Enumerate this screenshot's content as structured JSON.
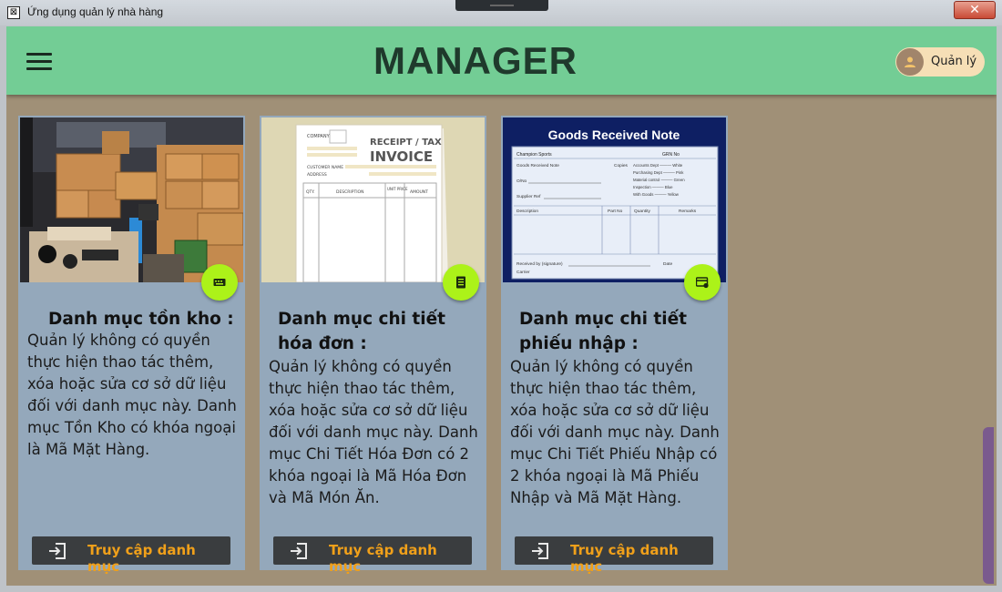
{
  "window": {
    "title": "Ứng dụng quản lý nhà hàng",
    "app_icon_glyph": "⊠",
    "close_glyph": "✕"
  },
  "header": {
    "title": "MANAGER",
    "menu_icon": "hamburger-icon",
    "user": {
      "label": "Quản lý",
      "icon": "user-icon"
    },
    "background": "#73cd95"
  },
  "cards": [
    {
      "title": "Danh mục tồn kho :",
      "description": "Quản lý không có quyền thực hiện thao tác thêm, xóa hoặc sửa cơ sở dữ liệu đối với danh mục này. Danh mục Tồn Kho có khóa ngoại là Mã Mặt Hàng.",
      "fab_icon": "keyboard-icon",
      "button_label": "Truy cập danh mục",
      "button_icon": "login-icon"
    },
    {
      "title": "Danh mục chi tiết hóa đơn :",
      "description": "Quản lý không có quyền thực hiện thao tác thêm, xóa hoặc sửa cơ sở dữ liệu đối với danh mục này. Danh mục Chi Tiết Hóa Đơn có 2 khóa ngoại là Mã Hóa Đơn và Mã Món Ăn.",
      "fab_icon": "receipt-icon",
      "button_label": "Truy cập danh mục",
      "button_icon": "login-icon",
      "image_text": {
        "line1": "RECEIPT / TAX",
        "line2": "INVOICE",
        "company": "COMPANY",
        "customer_name": "CUSTOMER NAME",
        "address": "ADDRESS",
        "columns": [
          "QTY.",
          "DESCRIPTION",
          "UNIT PRICE",
          "AMOUNT"
        ]
      }
    },
    {
      "title": "Danh mục chi tiết phiếu nhập :",
      "description": "Quản lý không có quyền thực hiện thao tác thêm, xóa hoặc sửa cơ sở dữ liệu đối với danh mục này. Danh mục Chi Tiết Phiếu Nhập có 2 khóa ngoại là Mã Phiếu Nhập và Mã Mặt Hàng.",
      "fab_icon": "payment-card-icon",
      "button_label": "Truy cập danh mục",
      "button_icon": "login-icon",
      "image_text": {
        "heading": "Goods Received Note",
        "company": "Champion Sports",
        "grn_no": "GRN No",
        "form_name": "Goods Received Note",
        "copies": "Copies",
        "copy_list": [
          "Accounts Dept ——— White",
          "Purchasing Dept ——— Pink",
          "Material control ——— Green",
          "Inspection ——— Blue",
          "With Goods ——— Yellow"
        ],
        "order_no": "O/No",
        "supplier_ref": "Supplier Ref",
        "columns": [
          "Description",
          "Part No",
          "Quantity",
          "Remarks"
        ],
        "received_by": "Received by (signature)",
        "date": "Date",
        "carrier": "Carrier"
      }
    }
  ],
  "colors": {
    "content_background": "#a09077",
    "card_background": "#94a8bb",
    "fab": "#acf219",
    "button_background": "#3a3d3f",
    "button_text": "#f0a01a",
    "scrollbar": "#7a5a8e"
  }
}
